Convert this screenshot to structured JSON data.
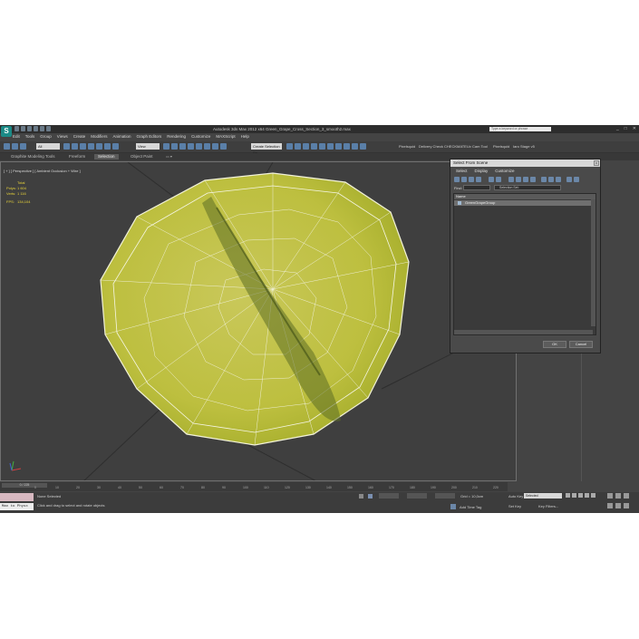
{
  "app": {
    "title": "Autodesk 3ds Max 2012 x64     Green_Grape_Cross_Section_3_smooth2.max",
    "logo": "S",
    "search_placeholder": "Type a keyword or phrase",
    "window_buttons": [
      "_",
      "□",
      "✕"
    ]
  },
  "menu": [
    "Edit",
    "Tools",
    "Group",
    "Views",
    "Create",
    "Modifiers",
    "Animation",
    "Graph Editors",
    "Rendering",
    "Customize",
    "MAXScript",
    "Help"
  ],
  "toolbar": {
    "filter_select": "All",
    "view_select": "View",
    "selection_set_placeholder": "Create Selection Se",
    "right_items": [
      "Pixelsquid",
      "Delivery Check",
      "CHECKMATE",
      "Uv Cam Tool",
      "Pixelsquid",
      "Iaro Stage v5"
    ]
  },
  "ribbon": {
    "tabs": [
      "Graphite Modeling Tools",
      "Freeform",
      "Selection",
      "Object Paint"
    ],
    "active_tab": "Selection"
  },
  "viewport": {
    "label": "[ + ] [ Perspective ] [ Ambient Occlusion + Wire ]",
    "stats": {
      "header": "Total",
      "polys_label": "Polys:",
      "polys_value": "1 604",
      "verts_label": "Verts:",
      "verts_value": "1 116",
      "fps_label": "FPS:",
      "fps_value": "134,104"
    },
    "fruit_color": "#c8c94a",
    "wire_color": "#ffffff"
  },
  "timeline": {
    "slider_label": "0 / 225",
    "ticks": [
      "0",
      "10",
      "20",
      "30",
      "40",
      "50",
      "60",
      "70",
      "80",
      "90",
      "100",
      "110",
      "120",
      "130",
      "140",
      "150",
      "160",
      "170",
      "180",
      "190",
      "200",
      "210",
      "220"
    ]
  },
  "status": {
    "maxscript_label": "Max to Physx",
    "selection_status": "None Selected",
    "prompt": "Click and drag to select and rotate objects",
    "grid_label": "Grid = 10,0cm",
    "add_time_tag": "Add Time Tag",
    "auto_key": "Auto Key",
    "auto_key_value": "Selected",
    "set_key": "Set Key",
    "key_filters": "Key Filters..."
  },
  "dialog": {
    "title": "Select From Scene",
    "close": "x",
    "menu": [
      "Select",
      "Display",
      "Customize"
    ],
    "find_label": "Find:",
    "selection_set_label": "Selection Set:",
    "column_header": "Name",
    "items": [
      "GreenGrapeGroup"
    ],
    "ok": "OK",
    "cancel": "Cancel"
  }
}
